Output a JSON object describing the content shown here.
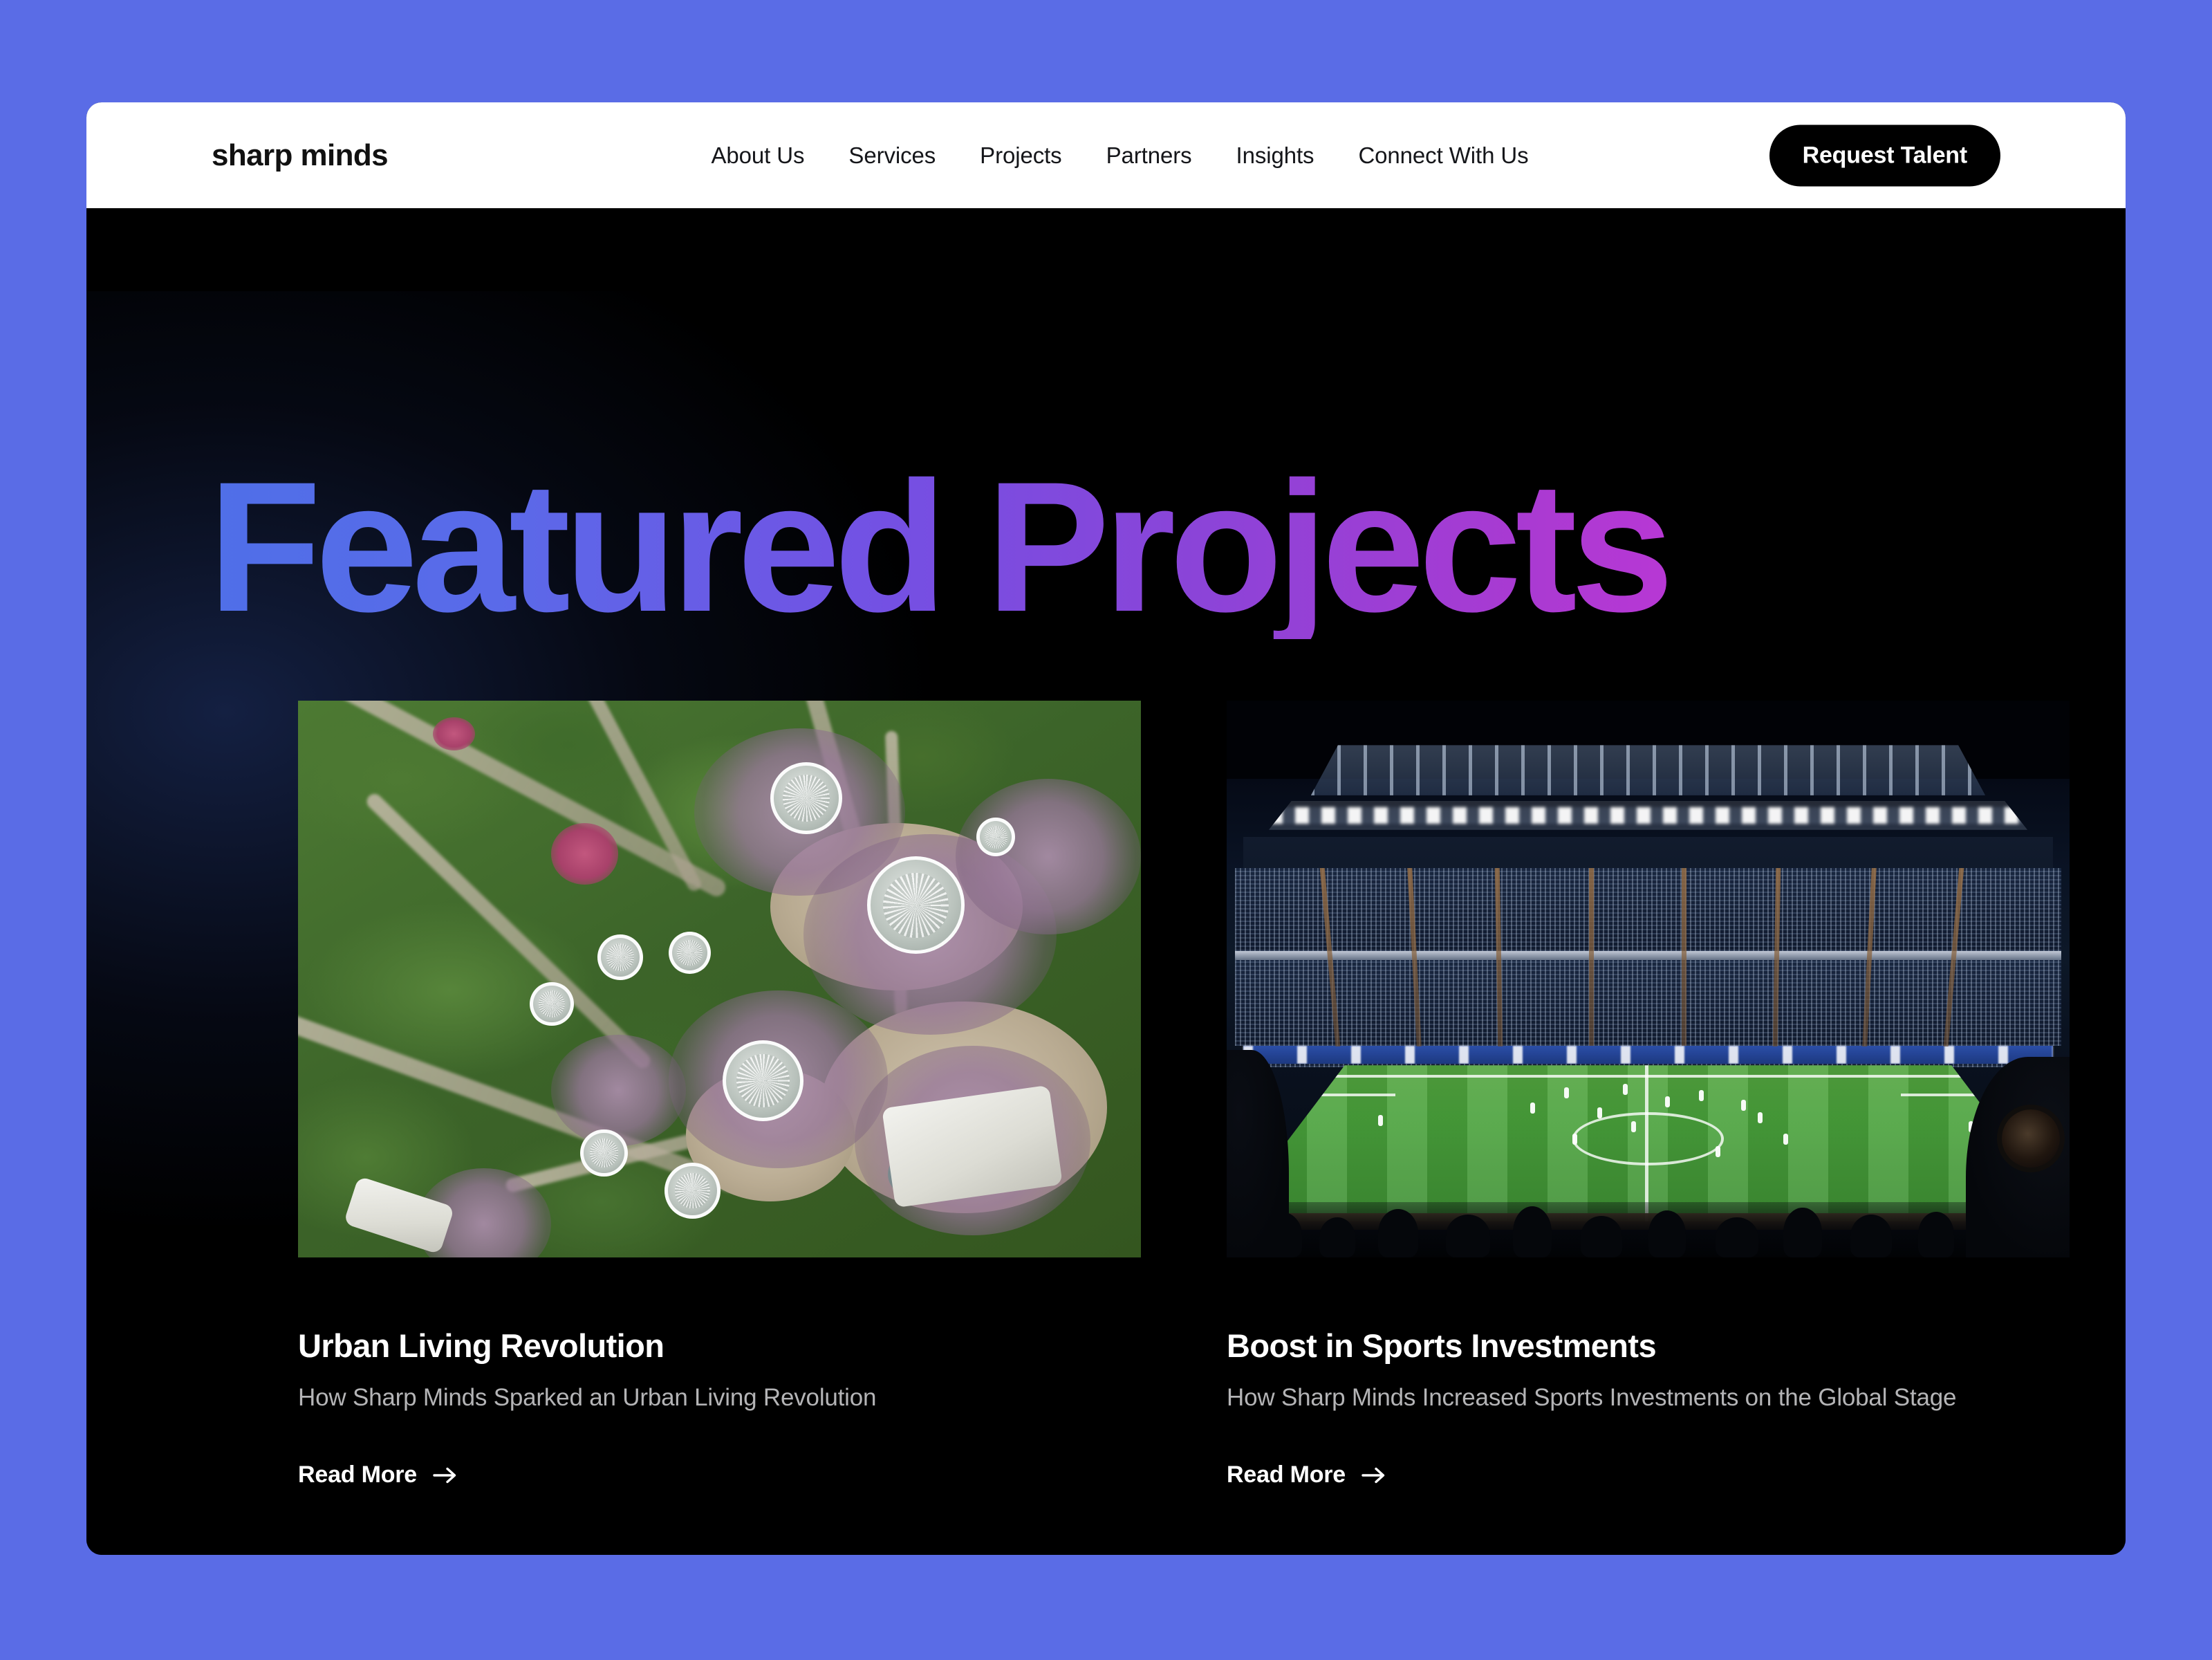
{
  "theme": {
    "page_background": "#5a6ce6",
    "card_background": "#000000",
    "header_background": "#ffffff",
    "accent_gradient_start": "#4f6fe8",
    "accent_gradient_mid": "#8b44d8",
    "accent_gradient_end": "#cb33d5",
    "button_background": "#000000",
    "button_text": "#ffffff",
    "subtitle_text": "#b4b4b6"
  },
  "header": {
    "brand": "sharp minds",
    "nav": [
      {
        "label": "About Us"
      },
      {
        "label": "Services"
      },
      {
        "label": "Projects"
      },
      {
        "label": "Partners"
      },
      {
        "label": "Insights"
      },
      {
        "label": "Connect With Us"
      }
    ],
    "cta": {
      "label": "Request Talent"
    }
  },
  "hero": {
    "title": "Featured Projects"
  },
  "projects": [
    {
      "title": "Urban Living Revolution",
      "subtitle": "How Sharp Minds Sparked an Urban Living Revolution",
      "link_label": "Read More",
      "link_icon": "arrow-right-icon",
      "image_alt": "Aerial view of a lush green urban garden park with circular supertree canopies and winding pathways"
    },
    {
      "title": "Boost in Sports Investments",
      "subtitle": "How Sharp Minds Increased Sports Investments on the Global Stage",
      "link_label": "Read More",
      "link_icon": "arrow-right-icon",
      "image_alt": "Night view of a packed football stadium with floodlit striped green pitch seen from the stands"
    }
  ]
}
